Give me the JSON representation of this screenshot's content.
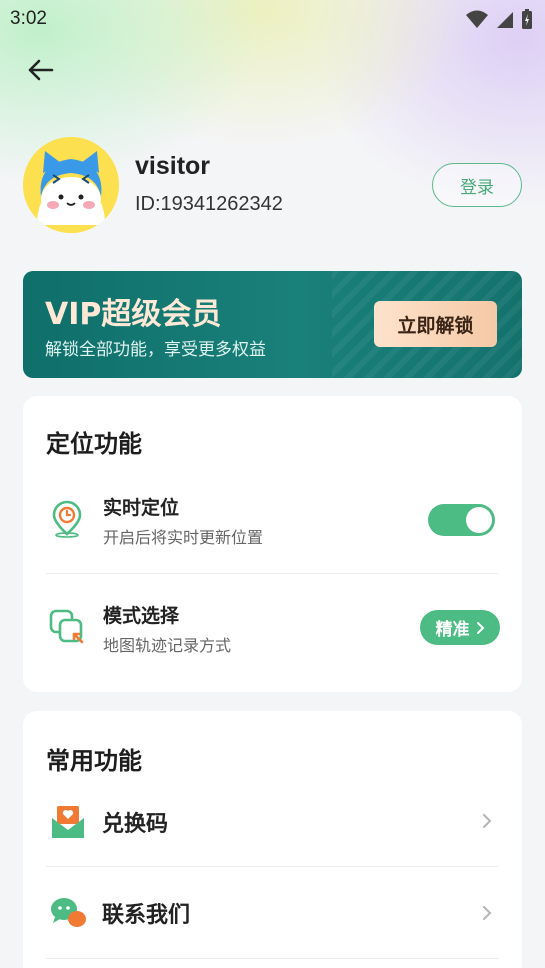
{
  "status_bar": {
    "time": "3:02"
  },
  "user": {
    "name": "visitor",
    "id": "ID:19341262342",
    "login_label": "登录"
  },
  "vip": {
    "title": "VIP超级会员",
    "subtitle": "解锁全部功能，享受更多权益",
    "button": "立即解锁"
  },
  "location": {
    "title": "定位功能",
    "realtime": {
      "title": "实时定位",
      "subtitle": "开启后将实时更新位置",
      "enabled": true
    },
    "mode": {
      "title": "模式选择",
      "subtitle": "地图轨迹记录方式",
      "value": "精准"
    }
  },
  "common": {
    "title": "常用功能",
    "items": [
      {
        "label": "兑换码"
      },
      {
        "label": "联系我们"
      }
    ]
  },
  "colors": {
    "accent": "#4dbb84",
    "vip_bg": "#137570",
    "vip_button": "#f7d0b0"
  }
}
